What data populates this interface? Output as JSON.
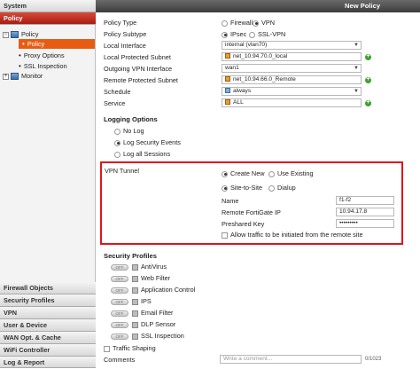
{
  "sidebar": {
    "system": "System",
    "policy": "Policy",
    "tree_policy": "Policy",
    "tree_policy_sub": "Policy",
    "proxy_options": "Proxy Options",
    "ssl_inspection": "SSL Inspection",
    "monitor": "Monitor",
    "firewall_objects": "Firewall Objects",
    "security_profiles": "Security Profiles",
    "vpn": "VPN",
    "user_device": "User & Device",
    "wan_opt": "WAN Opt. & Cache",
    "wifi": "WiFi Controller",
    "log_report": "Log & Report"
  },
  "header": {
    "title": "New Policy"
  },
  "form": {
    "policy_type_label": "Policy Type",
    "policy_type_options": [
      "Firewall",
      "VPN"
    ],
    "policy_type_selected": "VPN",
    "policy_subtype_label": "Policy Subtype",
    "policy_subtype_options": [
      "IPsec",
      "SSL-VPN"
    ],
    "policy_subtype_selected": "IPsec",
    "local_interface_label": "Local Interface",
    "local_interface_value": "internal (vlan70)",
    "local_subnet_label": "Local Protected Subnet",
    "local_subnet_value": "net_10.94.70.0_local",
    "outgoing_vpn_label": "Outgoing VPN Interface",
    "outgoing_vpn_value": "wan1",
    "remote_subnet_label": "Remote Protected Subnet",
    "remote_subnet_value": "net_10.94.66.0_Remote",
    "schedule_label": "Schedule",
    "schedule_value": "always",
    "service_label": "Service",
    "service_value": "ALL"
  },
  "logging": {
    "title": "Logging Options",
    "options": [
      "No Log",
      "Log Security Events",
      "Log all Sessions"
    ],
    "selected": "Log Security Events"
  },
  "vpn_tunnel": {
    "label": "VPN Tunnel",
    "mode_options": [
      "Create New",
      "Use Existing"
    ],
    "mode_selected": "Create New",
    "type_options": [
      "Site-to-Site",
      "Dialup"
    ],
    "type_selected": "Site-to-Site",
    "name_label": "Name",
    "name_value": "f1-f2",
    "remote_ip_label": "Remote FortiGate IP",
    "remote_ip_value": "10.94.17.8",
    "preshared_label": "Preshared Key",
    "preshared_value": "•••••••••",
    "allow_remote_label": "Allow traffic to be initiated from the remote site"
  },
  "security_profiles": {
    "title": "Security Profiles",
    "toggle_label": "OFF",
    "items": [
      "AntiVirus",
      "Web Filter",
      "Application Control",
      "IPS",
      "Email Filter",
      "DLP Sensor",
      "SSL Inspection"
    ]
  },
  "traffic_shaping": "Traffic Shaping",
  "comments": {
    "label": "Comments",
    "placeholder": "Write a comment...",
    "counter": "0/1023"
  },
  "colors": {
    "accent": "#e85c12",
    "highlight_box": "#e0141b",
    "add_icon": "#3fa12f"
  }
}
